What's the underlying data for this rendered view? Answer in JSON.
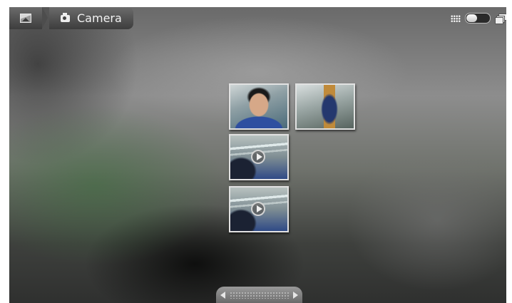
{
  "topbar": {
    "home_icon": "gallery-icon",
    "album_icon": "camera-icon",
    "album_title": "Camera",
    "view_icons": [
      "grid-view-icon",
      "view-toggle",
      "stack-view-icon"
    ]
  },
  "grid": {
    "items": [
      {
        "type": "photo",
        "subject": "person"
      },
      {
        "type": "photo",
        "subject": "jar"
      },
      {
        "type": "video",
        "subject": "office"
      },
      {
        "type": "video",
        "subject": "office"
      }
    ]
  },
  "scroller": {
    "left_icon": "arrow-left-icon",
    "right_icon": "arrow-right-icon"
  }
}
